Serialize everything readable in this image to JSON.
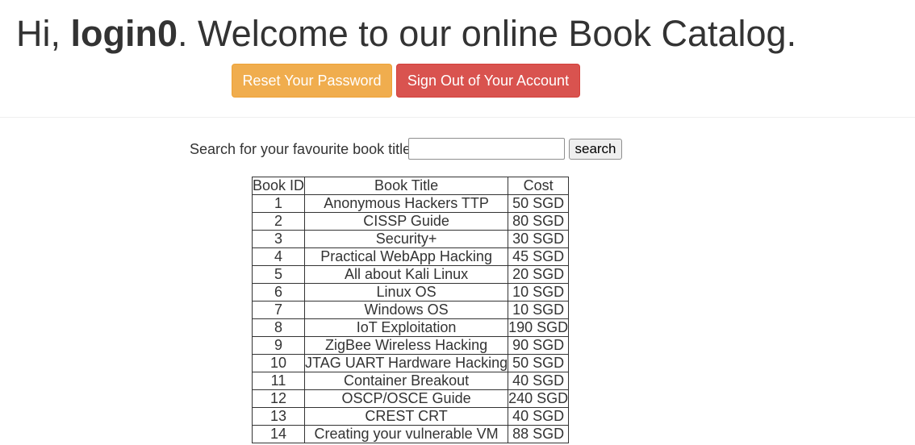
{
  "header": {
    "greeting_prefix": "Hi, ",
    "username": "login0",
    "greeting_suffix": ". Welcome to our online Book Catalog."
  },
  "actions": {
    "reset_password_label": "Reset Your Password",
    "sign_out_label": "Sign Out of Your Account",
    "colors": {
      "reset_password_bg": "#f0ad4e",
      "sign_out_bg": "#d9534f"
    }
  },
  "search": {
    "label": "Search for your favourite book title",
    "value": "",
    "placeholder": "",
    "button_label": "search"
  },
  "table": {
    "headers": [
      "Book ID",
      "Book Title",
      "Cost"
    ],
    "rows": [
      {
        "id": "1",
        "title": "Anonymous Hackers TTP",
        "cost": "50 SGD"
      },
      {
        "id": "2",
        "title": "CISSP Guide",
        "cost": "80 SGD"
      },
      {
        "id": "3",
        "title": "Security+",
        "cost": "30 SGD"
      },
      {
        "id": "4",
        "title": "Practical WebApp Hacking",
        "cost": "45 SGD"
      },
      {
        "id": "5",
        "title": "All about Kali Linux",
        "cost": "20 SGD"
      },
      {
        "id": "6",
        "title": "Linux OS",
        "cost": "10 SGD"
      },
      {
        "id": "7",
        "title": "Windows OS",
        "cost": "10 SGD"
      },
      {
        "id": "8",
        "title": "IoT Exploitation",
        "cost": "190 SGD"
      },
      {
        "id": "9",
        "title": "ZigBee Wireless Hacking",
        "cost": "90 SGD"
      },
      {
        "id": "10",
        "title": "JTAG UART Hardware Hacking",
        "cost": "50 SGD"
      },
      {
        "id": "11",
        "title": "Container Breakout",
        "cost": "40 SGD"
      },
      {
        "id": "12",
        "title": "OSCP/OSCE Guide",
        "cost": "240 SGD"
      },
      {
        "id": "13",
        "title": "CREST CRT",
        "cost": "40 SGD"
      },
      {
        "id": "14",
        "title": "Creating your vulnerable VM",
        "cost": "88 SGD"
      }
    ]
  }
}
